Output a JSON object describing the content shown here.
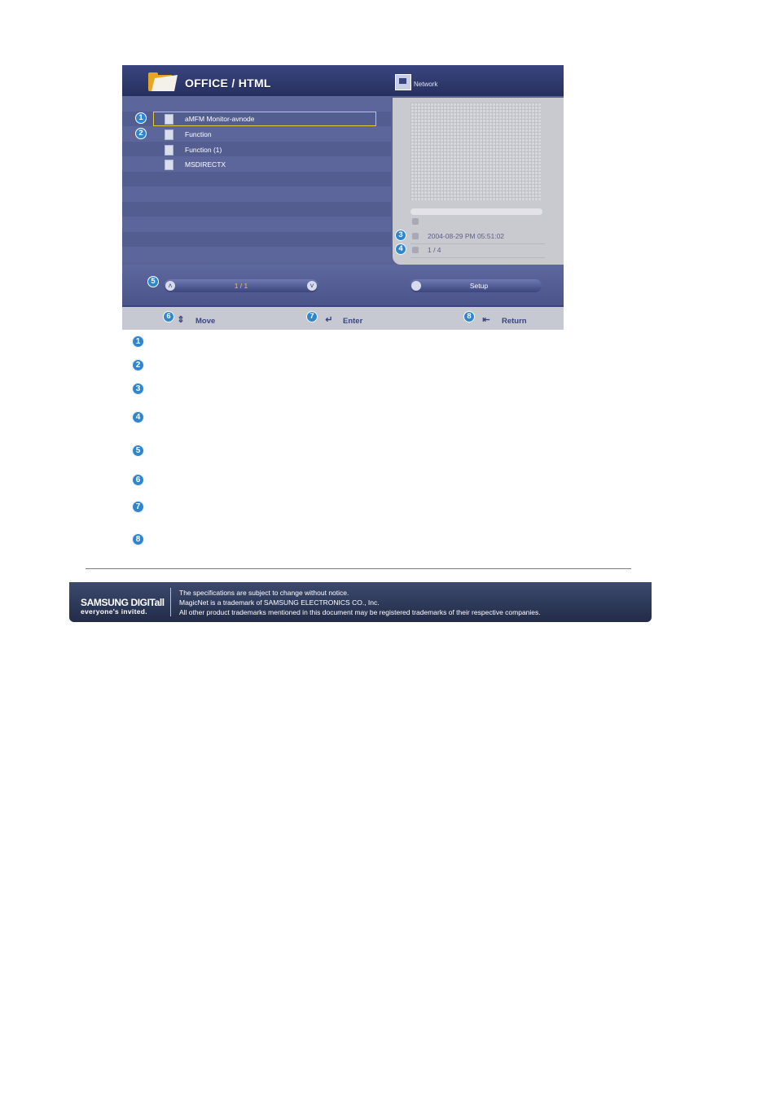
{
  "screen": {
    "title": "OFFICE / HTML",
    "network_label": "Network",
    "files": [
      {
        "label": "aMFM Monitor-avnode"
      },
      {
        "label": "Function"
      },
      {
        "label": "Function (1)"
      },
      {
        "label": "MSDIRECTX"
      }
    ],
    "date": "2004-08-29 PM 05:51:02",
    "page_count": "1 / 4",
    "pager": "1 / 1",
    "setup_label": "Setup",
    "nav": {
      "move": "Move",
      "enter": "Enter",
      "return": "Return"
    },
    "callouts": [
      "1",
      "2",
      "3",
      "4",
      "5",
      "6",
      "7",
      "8"
    ]
  },
  "legend_numbers": [
    "1",
    "2",
    "3",
    "4",
    "5",
    "6",
    "7",
    "8"
  ],
  "footer": {
    "brand": "SAMSUNG DIGITall",
    "tagline": "everyone's invited.",
    "notes": [
      "The specifications are subject to change without notice.",
      "MagicNet is a trademark of SAMSUNG ELECTRONICS CO., Inc.",
      "All other product trademarks mentioned in this document may be registered trademarks of their respective companies."
    ]
  },
  "colors": {
    "accent": "#2f86cf",
    "selection": "#e9c63a",
    "banner": "#2a3556"
  }
}
